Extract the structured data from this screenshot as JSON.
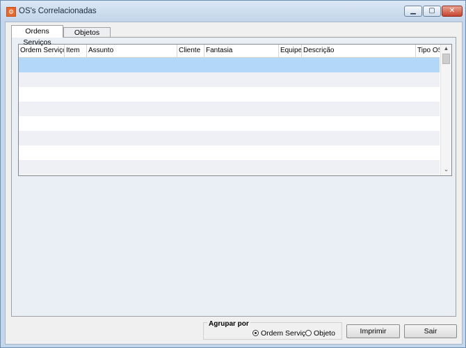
{
  "window": {
    "title": "OS's Correlacionadas",
    "app_icon": "app-logo-icon",
    "controls": {
      "minimize_glyph": "▁",
      "maximize_glyph": "▢",
      "close_glyph": "✕"
    }
  },
  "tabs": [
    {
      "label": "Ordens Serviços",
      "active": true
    },
    {
      "label": "Objetos",
      "active": false
    }
  ],
  "grid": {
    "columns": [
      "Ordem Serviço",
      "Item",
      "Assunto",
      "Cliente",
      "Fantasia",
      "Equipe",
      "Descrição",
      "Tipo OS"
    ],
    "rows": [],
    "selected_row": 0,
    "scroll_up_glyph": "▲",
    "scroll_down_glyph": "⌄"
  },
  "group_by": {
    "legend": "Agrupar por",
    "options": [
      "Ordem Serviço",
      "Objeto"
    ],
    "selected": "Ordem Serviço"
  },
  "buttons": {
    "print": "Imprimir",
    "exit": "Sair"
  },
  "colors": {
    "selected_row": "#b3d7f8",
    "stripe_row": "#eef0f6",
    "panel_bg": "#eaeff5",
    "frame": "#c4d6ea"
  }
}
